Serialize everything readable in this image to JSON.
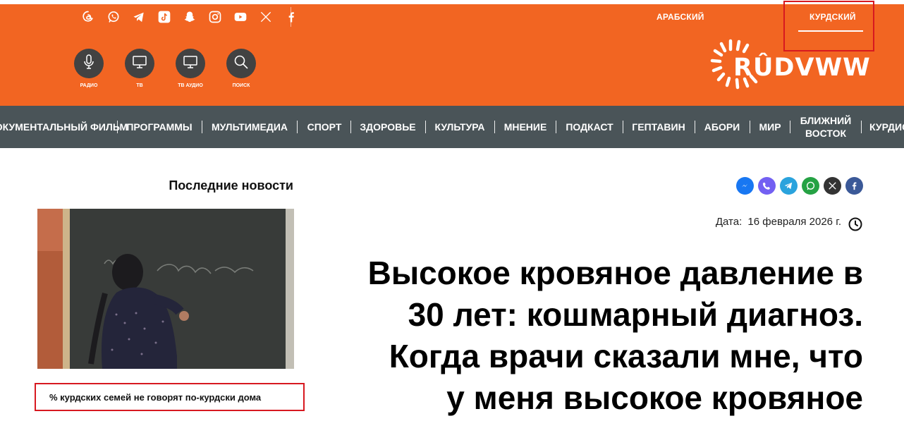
{
  "header": {
    "social_icons": [
      "threads-icon",
      "whatsapp-icon",
      "telegram-icon",
      "tiktok-icon",
      "snapchat-icon",
      "instagram-icon",
      "youtube-icon",
      "x-icon",
      "facebook-icon"
    ],
    "languages": {
      "arabic": "АРАБСКИЙ",
      "kurdish": "КУРДСКИЙ"
    },
    "media_buttons": [
      {
        "label": "РАДИО",
        "icon": "microphone-icon"
      },
      {
        "label": "ТВ",
        "icon": "tv-icon"
      },
      {
        "label": "ТВ АУДИО",
        "icon": "tv-audio-icon"
      },
      {
        "label": "ПОИСК",
        "icon": "search-icon"
      }
    ],
    "logo_text": "RÛDVWW"
  },
  "nav": {
    "items": [
      "ДОКУМЕНТАЛЬНЫЙ ФИЛЬМ",
      "ПРОГРАММЫ",
      "МУЛЬТИМЕДИА",
      "СПОРТ",
      "ЗДОРОВЬЕ",
      "КУЛЬТУРА",
      "МНЕНИЕ",
      "ПОДКАСТ",
      "ГЕПТАВИН",
      "АБОРИ",
      "МИР",
      "БЛИЖНИЙ ВОСТОК",
      "КУРДИС"
    ]
  },
  "latest": {
    "title": "Последние новости",
    "caption": "% курдских семей не говорят по-курдски дома"
  },
  "article": {
    "share_icons": [
      "messenger-icon",
      "viber-icon",
      "telegram-icon",
      "whatsapp-icon",
      "x-icon",
      "facebook-icon"
    ],
    "date_label": "Дата:",
    "date_value": "16 февраля 2026 г.",
    "headline_lines": [
      "Высокое кровяное давление в",
      "30 лет: кошмарный диагноз.",
      "Когда врачи сказали мне, что",
      "у меня высокое кровяное"
    ]
  },
  "colors": {
    "header_orange": "#f26522",
    "nav_gray": "#4a5458",
    "highlight_red": "#d71920"
  }
}
